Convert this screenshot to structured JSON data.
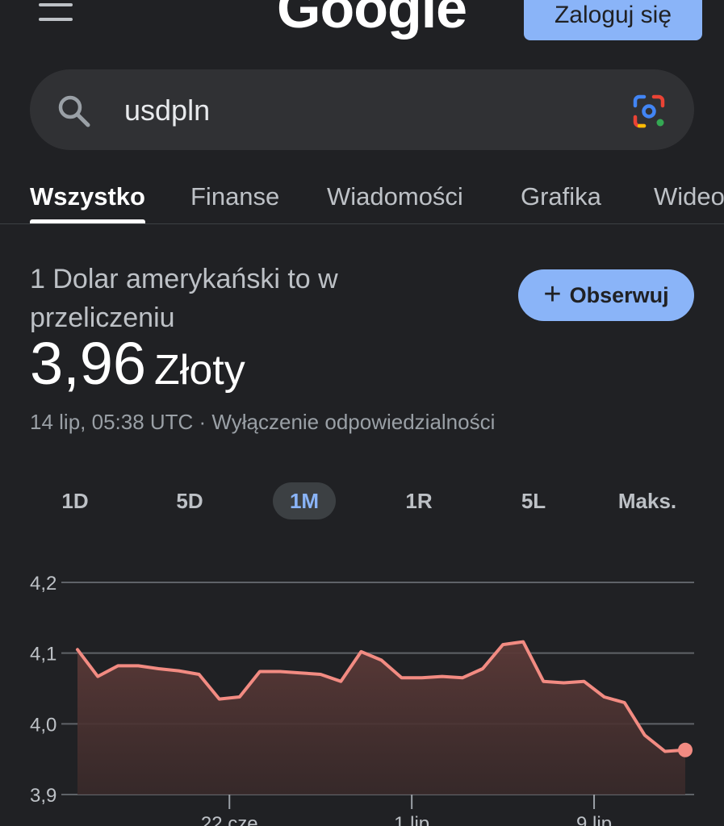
{
  "header": {
    "menu_icon": "menu-icon",
    "logo_text": "Google",
    "signin_label": "Zaloguj się"
  },
  "search": {
    "query": "usdpln",
    "search_icon": "search-icon",
    "lens_icon": "google-lens-icon"
  },
  "tabs": [
    {
      "label": "Wszystko",
      "active": true
    },
    {
      "label": "Finanse",
      "active": false
    },
    {
      "label": "Wiadomości",
      "active": false
    },
    {
      "label": "Grafika",
      "active": false
    },
    {
      "label": "Wideo",
      "active": false
    }
  ],
  "conversion": {
    "label": "1 Dolar amerykański to w przeliczeniu",
    "value": "3,96",
    "currency": "Złoty",
    "timestamp": "14 lip, 05:38 UTC · Wyłączenie odpowiedzialności",
    "follow_label": "Obserwuj"
  },
  "ranges": [
    {
      "label": "1D",
      "active": false
    },
    {
      "label": "5D",
      "active": false
    },
    {
      "label": "1M",
      "active": true
    },
    {
      "label": "1R",
      "active": false
    },
    {
      "label": "5L",
      "active": false
    },
    {
      "label": "Maks.",
      "active": false
    }
  ],
  "colors": {
    "background": "#202124",
    "accent": "#8ab4f8",
    "line": "#f28b82"
  },
  "chart_data": {
    "type": "area",
    "series": [
      {
        "values": [
          4.105,
          4.067,
          4.082,
          4.082,
          4.078,
          4.075,
          4.07,
          4.035,
          4.038,
          4.074,
          4.074,
          4.072,
          4.07,
          4.06,
          4.102,
          4.09,
          4.065,
          4.065,
          4.067,
          4.065,
          4.078,
          4.112,
          4.116,
          4.06,
          4.058,
          4.06,
          4.038,
          4.03,
          3.984,
          3.961,
          3.963
        ]
      }
    ],
    "x_tick_labels": [
      "22 cze",
      "1 lip",
      "9 lip"
    ],
    "x_tick_index": [
      7.5,
      16.5,
      25.5
    ],
    "y_ticks": [
      "4,2",
      "4,1",
      "4,0",
      "3,9"
    ],
    "y_tick_values": [
      4.2,
      4.1,
      4.0,
      3.9
    ],
    "ylim": [
      3.9,
      4.2
    ],
    "grid": true
  }
}
